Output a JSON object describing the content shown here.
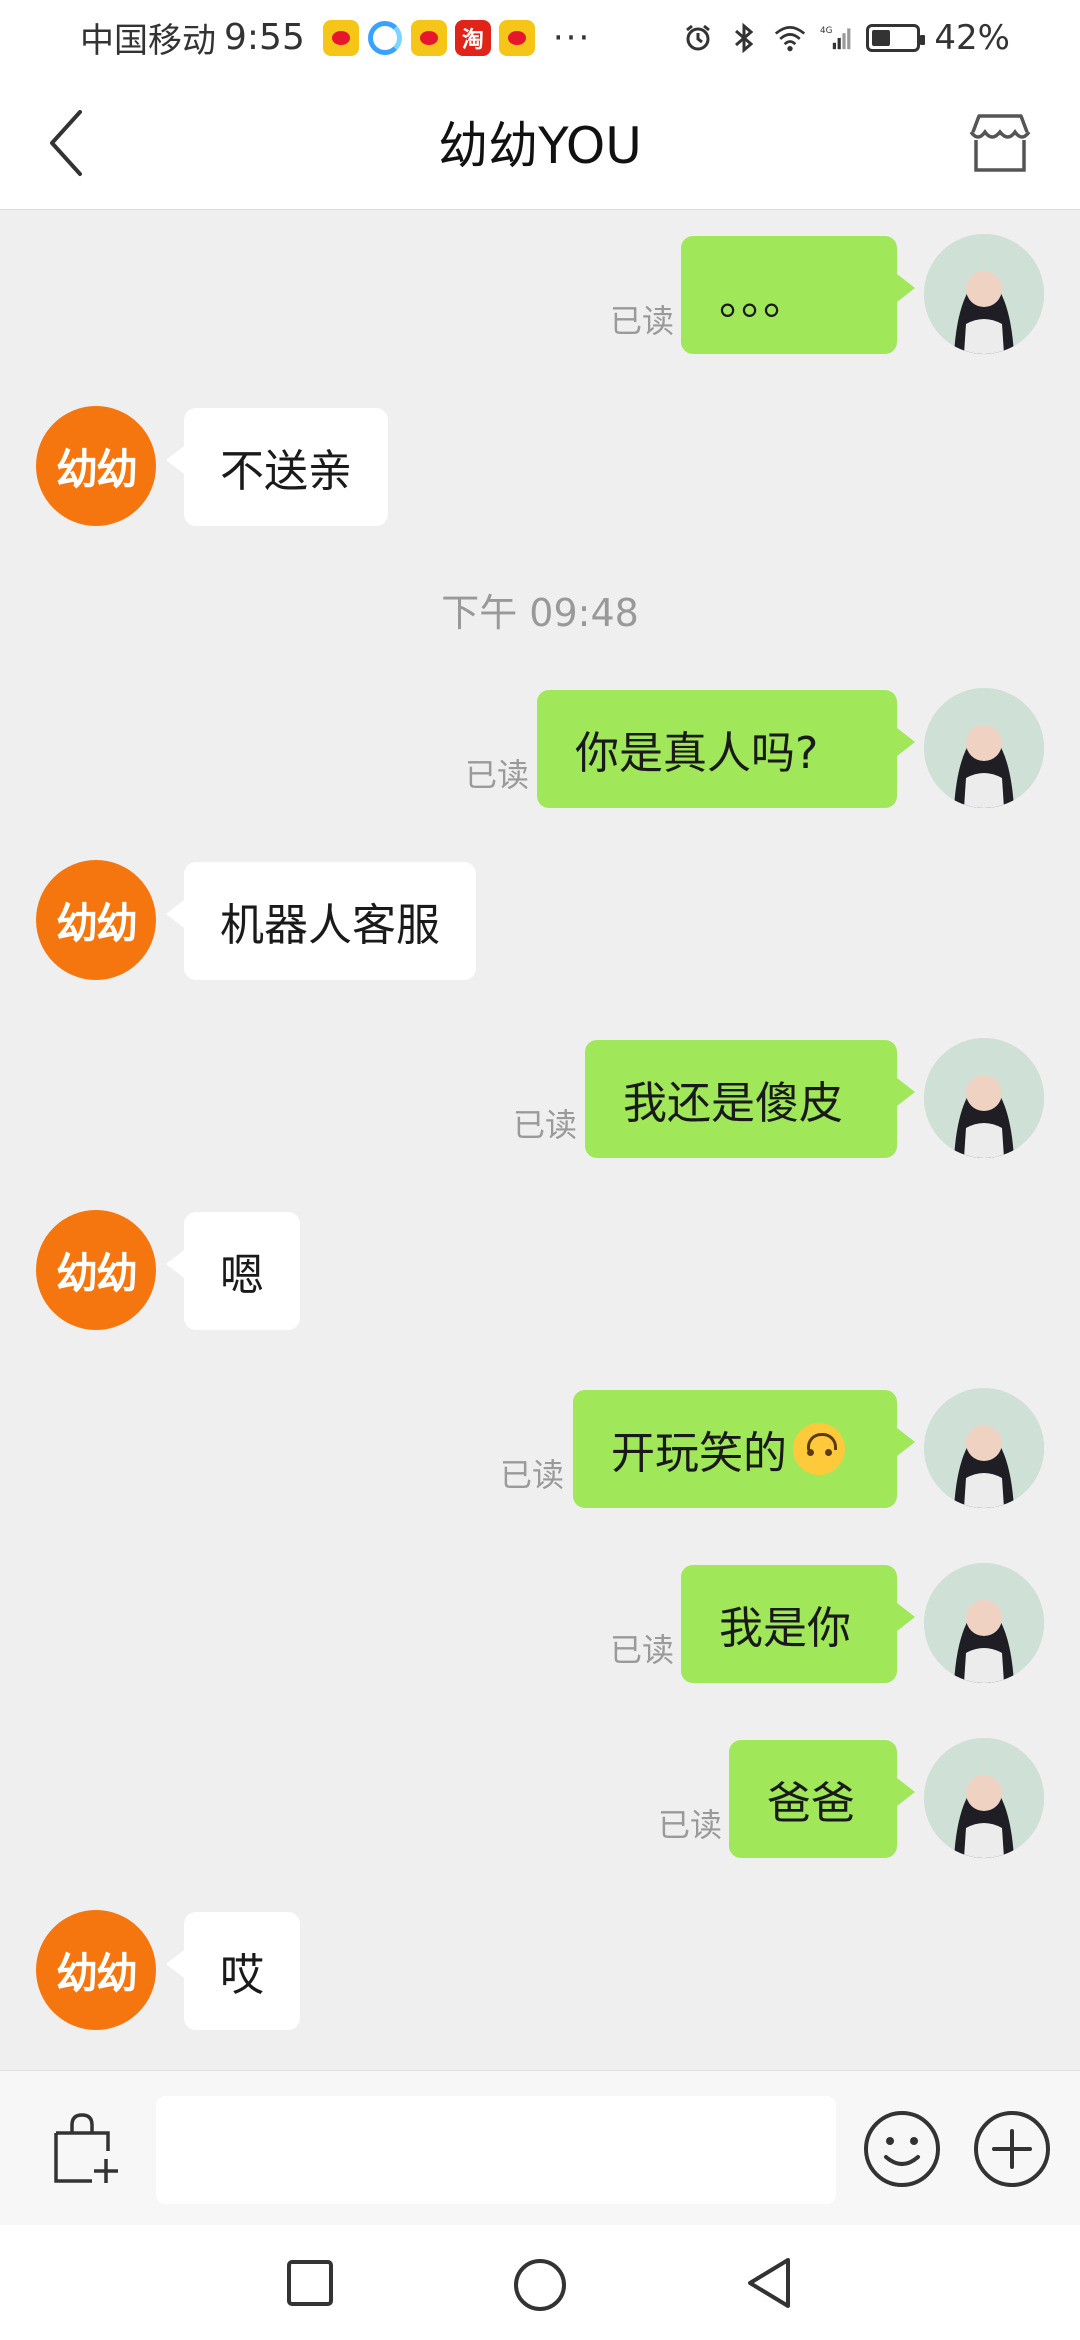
{
  "status_bar": {
    "carrier": "中国移动",
    "time": "9:55",
    "app_icons": [
      "weibo-icon",
      "qq-browser-icon",
      "weibo-icon",
      "taobao-icon",
      "weibo-icon"
    ],
    "taobao_label": "淘",
    "more": "···",
    "network": "4G",
    "battery_percent": "42%",
    "battery_level": 0.42
  },
  "header": {
    "title": "幼幼YOU",
    "back_icon": "chevron-left-icon",
    "shop_icon": "store-icon"
  },
  "bot": {
    "avatar_text": "幼幼"
  },
  "messages": [
    {
      "side": "right",
      "text": "。。。",
      "status": "已读"
    },
    {
      "side": "left",
      "text": "不送亲"
    },
    {
      "type": "timestamp",
      "text": "下午 09:48"
    },
    {
      "side": "right",
      "text": "你是真人吗?",
      "status": "已读"
    },
    {
      "side": "left",
      "text": "机器人客服"
    },
    {
      "side": "right",
      "text": "我还是傻皮",
      "status": "已读"
    },
    {
      "side": "left",
      "text": "嗯"
    },
    {
      "side": "right",
      "text": "开玩笑的",
      "emoji": "upside-down-face-icon",
      "status": "已读"
    },
    {
      "side": "right",
      "text": "我是你",
      "status": "已读"
    },
    {
      "side": "right",
      "text": "爸爸",
      "status": "已读"
    },
    {
      "side": "left",
      "text": "哎"
    }
  ],
  "input_bar": {
    "value": "",
    "placeholder": "",
    "left_icon": "shopping-bag-add-icon",
    "emoji_icon": "smiley-icon",
    "plus_icon": "plus-circle-icon"
  },
  "nav_bar": {
    "icons": [
      "recents-square-icon",
      "home-circle-icon",
      "back-triangle-icon"
    ]
  },
  "colors": {
    "bubble_right": "#a0e75a",
    "bubble_left": "#ffffff",
    "bot_avatar": "#f5760e",
    "chat_bg": "#efefef"
  }
}
